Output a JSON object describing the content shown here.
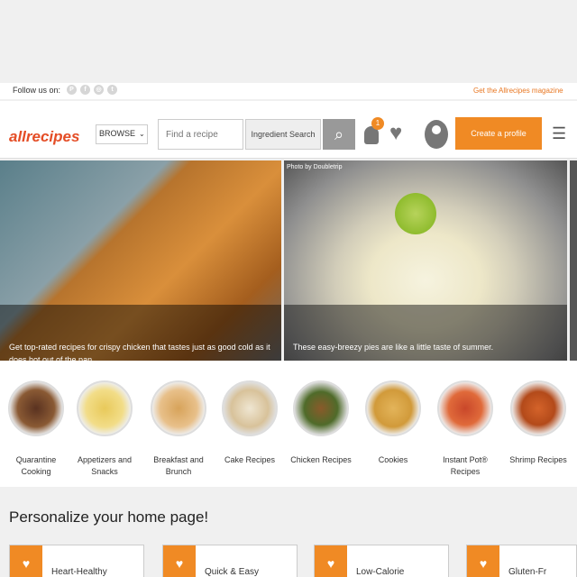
{
  "follow_label": "Follow us on:",
  "magazine_link": "Get the Allrecipes magazine",
  "logo": "allrecipes",
  "browse_label": "BROWSE",
  "search_placeholder": "Find a recipe",
  "ingredient_search": "Ingredient Search",
  "notification_count": "1",
  "create_profile": "Create a profile",
  "photo_credit": "Photo by Doubletrip",
  "hero": [
    {
      "caption": "Get top-rated recipes for crispy chicken that tastes just as good cold as it does hot out of the pan."
    },
    {
      "caption": "These easy-breezy pies are like a little taste of summer."
    }
  ],
  "categories": [
    {
      "label": "Quarantine Cooking"
    },
    {
      "label": "Appetizers and Snacks"
    },
    {
      "label": "Breakfast and Brunch"
    },
    {
      "label": "Cake Recipes"
    },
    {
      "label": "Chicken Recipes"
    },
    {
      "label": "Cookies"
    },
    {
      "label": "Instant Pot® Recipes"
    },
    {
      "label": "Shrimp Recipes"
    }
  ],
  "personalize_heading": "Personalize your home page!",
  "preferences": [
    {
      "label": "Heart-Healthy"
    },
    {
      "label": "Quick & Easy"
    },
    {
      "label": "Low-Calorie"
    },
    {
      "label": "Gluten-Fr"
    }
  ],
  "colors": {
    "accent": "#f08a24",
    "brand": "#e44d26"
  }
}
